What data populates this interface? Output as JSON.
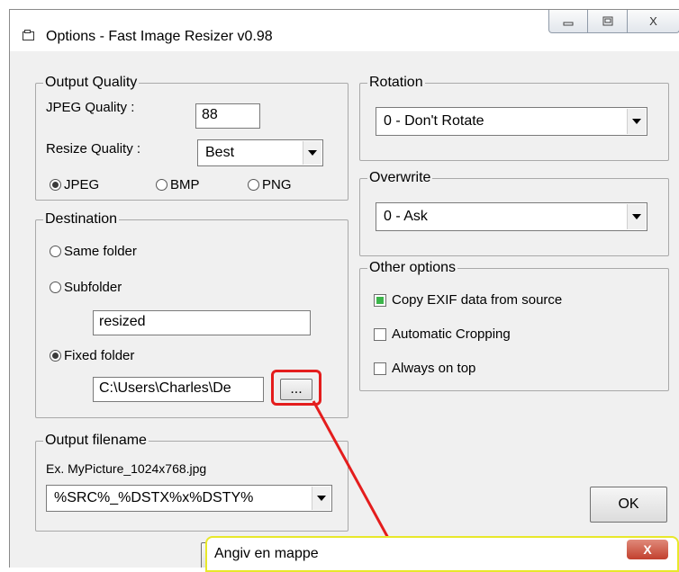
{
  "window": {
    "title": "Options - Fast Image Resizer v0.98",
    "controls": {
      "minimize_icon": "minimize-icon",
      "maximize_icon": "maximize-icon",
      "close_glyph": "X"
    }
  },
  "output_quality": {
    "legend": "Output Quality",
    "jpeg_quality_label": "JPEG Quality :",
    "jpeg_quality_value": "88",
    "resize_quality_label": "Resize Quality :",
    "resize_quality_value": "Best",
    "formats": [
      {
        "label": "JPEG",
        "selected": true
      },
      {
        "label": "BMP",
        "selected": false
      },
      {
        "label": "PNG",
        "selected": false
      }
    ]
  },
  "destination": {
    "legend": "Destination",
    "same_folder_label": "Same folder",
    "subfolder_label": "Subfolder",
    "subfolder_value": "resized",
    "fixed_folder_label": "Fixed folder",
    "fixed_folder_value": "C:\\Users\\Charles\\De",
    "browse_label": "...",
    "selected": "fixed_folder"
  },
  "output_filename": {
    "legend": "Output filename",
    "example": "Ex. MyPicture_1024x768.jpg",
    "pattern_value": "%SRC%_%DSTX%x%DSTY%"
  },
  "rotation": {
    "legend": "Rotation",
    "value": "0 - Don't Rotate"
  },
  "overwrite": {
    "legend": "Overwrite",
    "value": "0 - Ask"
  },
  "other_options": {
    "legend": "Other options",
    "items": [
      {
        "label": "Copy EXIF data from source",
        "checked": true
      },
      {
        "label": "Automatic Cropping",
        "checked": false
      },
      {
        "label": "Always on top",
        "checked": false
      }
    ]
  },
  "ok_label": "OK",
  "popup": {
    "title": "Angiv en mappe",
    "close_glyph": "X"
  },
  "colors": {
    "annotation_red": "#e41d1d",
    "annotation_yellow": "#e8e82a",
    "check_green": "#3bb54a"
  }
}
